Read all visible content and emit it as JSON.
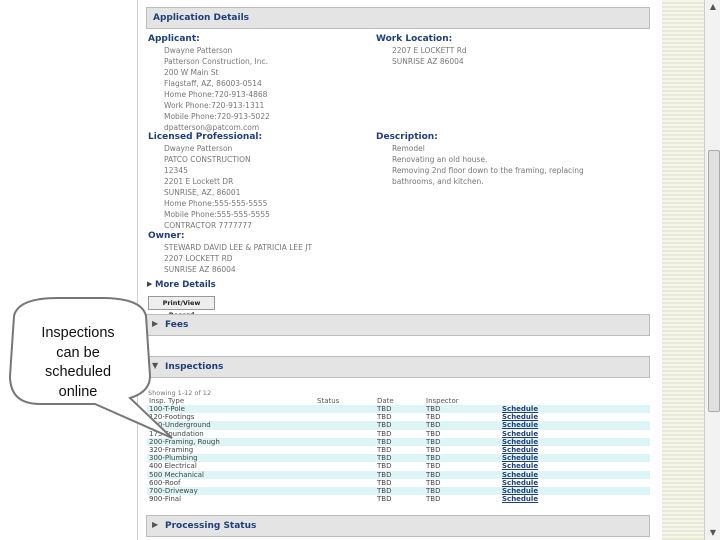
{
  "callout": {
    "text_lines": [
      "Inspections",
      "can be",
      "scheduled",
      "online"
    ]
  },
  "sections": {
    "application_details": "Application Details",
    "fees": "Fees",
    "inspections": "Inspections",
    "processing_status": "Processing Status"
  },
  "applicant": {
    "heading": "Applicant:",
    "lines": [
      "Dwayne Patterson",
      "Patterson Construction, Inc.",
      "200 W Main St",
      "Flagstaff, AZ, 86003-0514",
      "Home Phone:720-913-4868",
      "Work Phone:720-913-1311",
      "Mobile Phone:720-913-5022",
      "dpatterson@patcom.com"
    ]
  },
  "work_location": {
    "heading": "Work Location:",
    "lines": [
      "2207 E LOCKETT Rd",
      "SUNRISE AZ 86004"
    ]
  },
  "licensed_professional": {
    "heading": "Licensed Professional:",
    "lines": [
      "Dwayne Patterson",
      "PATCO CONSTRUCTION",
      "12345",
      "2201 E Lockett DR",
      "SUNRISE, AZ, 86001",
      "Home Phone:555-555-5555",
      "Mobile Phone:555-555-5555",
      "CONTRACTOR 7777777"
    ]
  },
  "description": {
    "heading": "Description:",
    "lines": [
      "Remodel",
      "Renovating an old house.",
      "Removing 2nd floor down to the framing, replacing",
      "bathrooms, and kitchen."
    ]
  },
  "owner": {
    "heading": "Owner:",
    "lines": [
      "STEWARD DAVID LEE & PATRICIA LEE JT",
      "2207 LOCKETT RD",
      "SUNRISE AZ 86004"
    ]
  },
  "more_details": "More Details",
  "print_button": "Print/View Record",
  "inspections": {
    "showing": "Showing 1-12 of 12",
    "columns": [
      "Insp. Type",
      "Status",
      "Date",
      "Inspector",
      ""
    ],
    "rows": [
      [
        "100-T-Pole",
        "",
        "TBD",
        "TBD",
        "Schedule"
      ],
      [
        "120-Footings",
        "",
        "TBD",
        "TBD",
        "Schedule"
      ],
      [
        "150-Underground",
        "",
        "TBD",
        "TBD",
        "Schedule"
      ],
      [
        "175 Foundation",
        "",
        "TBD",
        "TBD",
        "Schedule"
      ],
      [
        "200-Framing, Rough",
        "",
        "TBD",
        "TBD",
        "Schedule"
      ],
      [
        "320-Framing",
        "",
        "TBD",
        "TBD",
        "Schedule"
      ],
      [
        "300-Plumbing",
        "",
        "TBD",
        "TBD",
        "Schedule"
      ],
      [
        "400 Electrical",
        "",
        "TBD",
        "TBD",
        "Schedule"
      ],
      [
        "500 Mechanical",
        "",
        "TBD",
        "TBD",
        "Schedule"
      ],
      [
        "600-Roof",
        "",
        "TBD",
        "TBD",
        "Schedule"
      ],
      [
        "700-Driveway",
        "",
        "TBD",
        "TBD",
        "Schedule"
      ],
      [
        "900-Final",
        "",
        "TBD",
        "TBD",
        "Schedule"
      ]
    ]
  },
  "colors": {
    "header_text": "#1f3f7a",
    "row_alt": "#ddf5f7",
    "section_bg": "#e4e4e4"
  }
}
